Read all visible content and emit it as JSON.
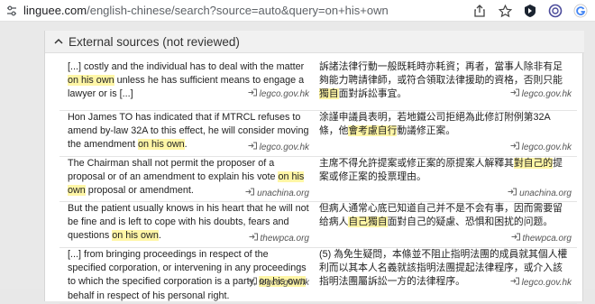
{
  "browser": {
    "url_domain": "linguee.com",
    "url_path": "/english-chinese/search?source=auto&query=on+his+own"
  },
  "section": {
    "title": "External sources (not reviewed)"
  },
  "rows": [
    {
      "en": [
        {
          "t": "[...] costly and the individual has to deal with the matter "
        },
        {
          "t": "on his own",
          "hl": true
        },
        {
          "t": " unless he has sufficient means to engage a lawyer or is [...]"
        }
      ],
      "en_source": "legco.gov.hk",
      "zh": [
        {
          "t": "訴諸法律行動一般既耗時亦耗資；再者，當事人除非有足夠能力聘請律師，或符合領取法律援助的資格，否則只能"
        },
        {
          "t": "獨自",
          "hl": true
        },
        {
          "t": "面對訴訟事宜。"
        }
      ],
      "zh_source": "legco.gov.hk"
    },
    {
      "en": [
        {
          "t": "Hon James TO has indicated that if MTRCL refuses to amend by-law 32A to this effect, he will consider moving the amendment "
        },
        {
          "t": "on his own",
          "hl": true
        },
        {
          "t": "."
        }
      ],
      "en_source": "legco.gov.hk",
      "zh": [
        {
          "t": "涂謹申議員表明，若地鐵公司拒絕為此修訂附例第32A條，他"
        },
        {
          "t": "會考慮自行",
          "hl": true
        },
        {
          "t": "動議修正案。"
        }
      ],
      "zh_source": "legco.gov.hk"
    },
    {
      "en": [
        {
          "t": "The Chairman shall not permit the proposer of a proposal or of an amendment to explain his vote "
        },
        {
          "t": "on his own",
          "hl": true
        },
        {
          "t": " proposal or amendment."
        }
      ],
      "en_source": "unachina.org",
      "zh": [
        {
          "t": "主席不得允許提案或修正案的原提案人解釋其"
        },
        {
          "t": "對自己的",
          "hl": true
        },
        {
          "t": "提案或修正案的投票理由。"
        }
      ],
      "zh_source": "unachina.org"
    },
    {
      "en": [
        {
          "t": "But the patient usually knows in his heart that he will not be fine and is left to cope with his doubts, fears and questions "
        },
        {
          "t": "on his own",
          "hl": true
        },
        {
          "t": "."
        }
      ],
      "en_source": "thewpca.org",
      "zh": [
        {
          "t": "但病人通常心底已知道自己并不是不会有事，因而需要留给病人"
        },
        {
          "t": "自己獨自",
          "hl": true
        },
        {
          "t": "面對自己的疑慮、恐惧和困扰的问题。"
        }
      ],
      "zh_source": "thewpca.org"
    },
    {
      "en": [
        {
          "t": "[...] from bringing proceedings in respect of the specified corporation, or intervening in any proceedings to which the specified corporation is a party, "
        },
        {
          "t": "on his own",
          "hl": true
        },
        {
          "t": " behalf in respect of his personal right."
        }
      ],
      "en_source": "legco.gov.hk",
      "zh": [
        {
          "t": "(5) 為免生疑問，本條並不阻止指明法團的成員就其個人權利而以其本人名義就該指明法團提起法律程序，或介入該指明法團屬訴訟一方的法律程序。"
        }
      ],
      "zh_source": "legco.gov.hk"
    }
  ]
}
